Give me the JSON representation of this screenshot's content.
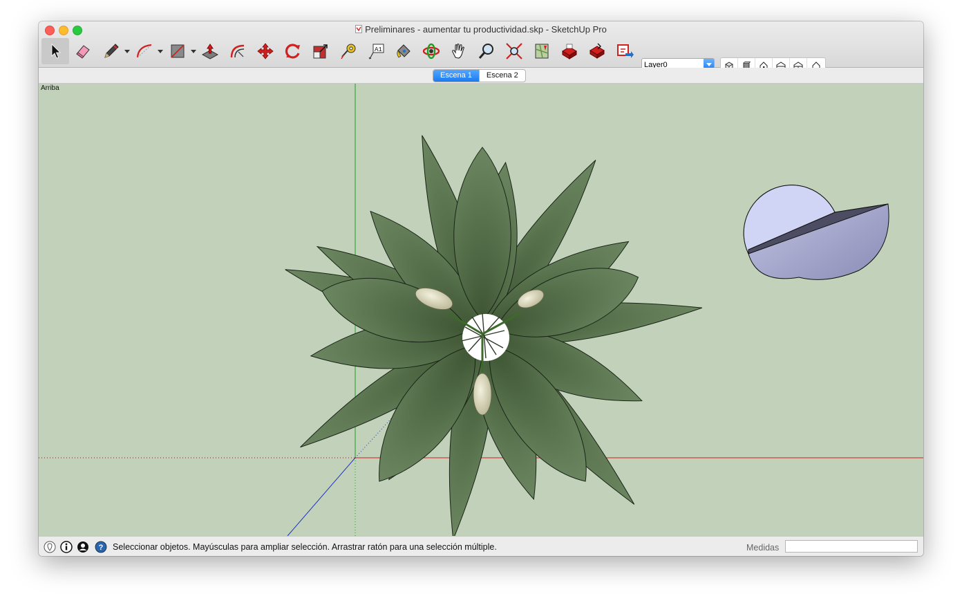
{
  "window": {
    "title": "Preliminares -  aumentar tu productividad.skp - SketchUp Pro"
  },
  "toolbar": {
    "tools": [
      {
        "name": "select-tool",
        "icon": "arrow-icon"
      },
      {
        "name": "eraser-tool",
        "icon": "eraser-icon"
      },
      {
        "name": "line-tool",
        "icon": "pencil-icon"
      },
      {
        "name": "arc-tool",
        "icon": "arc-icon"
      },
      {
        "name": "rectangle-tool",
        "icon": "rectangle-icon"
      },
      {
        "name": "push-pull-tool",
        "icon": "push-pull-icon"
      },
      {
        "name": "offset-tool",
        "icon": "offset-icon"
      },
      {
        "name": "move-tool",
        "icon": "move-icon"
      },
      {
        "name": "rotate-tool",
        "icon": "rotate-icon"
      },
      {
        "name": "scale-tool",
        "icon": "scale-icon"
      },
      {
        "name": "tape-measure-tool",
        "icon": "tape-measure-icon"
      },
      {
        "name": "text-tool",
        "icon": "text-icon"
      },
      {
        "name": "paint-bucket-tool",
        "icon": "paint-bucket-icon"
      },
      {
        "name": "orbit-tool",
        "icon": "orbit-icon"
      },
      {
        "name": "pan-tool",
        "icon": "hand-icon"
      },
      {
        "name": "zoom-tool",
        "icon": "magnifier-icon"
      },
      {
        "name": "zoom-extents-tool",
        "icon": "zoom-extents-icon"
      },
      {
        "name": "add-location-tool",
        "icon": "map-icon"
      },
      {
        "name": "3d-warehouse-tool",
        "icon": "warehouse-icon"
      },
      {
        "name": "share-model-tool",
        "icon": "share-model-icon"
      },
      {
        "name": "extension-warehouse-tool",
        "icon": "extension-icon"
      }
    ],
    "layer_value": "Layer0",
    "views": [
      "iso-view-icon",
      "top-view-icon",
      "front-view-icon",
      "right-view-icon",
      "back-view-icon",
      "left-view-icon"
    ]
  },
  "scenes": {
    "tabs": [
      {
        "label": "Escena 1",
        "active": true
      },
      {
        "label": "Escena 2",
        "active": false
      }
    ]
  },
  "viewport": {
    "label": "Arriba"
  },
  "statusbar": {
    "message": "Seleccionar objetos. Mayúsculas para ampliar selección. Arrastrar ratón para una selección múltiple.",
    "measures_label": "Medidas",
    "measures_value": "",
    "icons": [
      "geolocation-icon",
      "credits-icon",
      "user-icon",
      "help-icon"
    ]
  },
  "colors": {
    "viewport_bg": "#c1d1ba",
    "axis_red": "#d02020",
    "axis_green": "#20a020",
    "axis_blue": "#2030c0",
    "leaf": "#56704a",
    "accent": "#1f7ef5"
  }
}
